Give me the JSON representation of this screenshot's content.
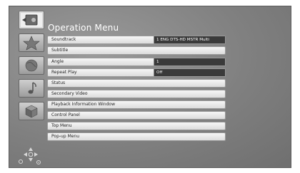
{
  "menu": {
    "title": "Operation Menu",
    "items": [
      {
        "label": "Soundtrack",
        "value": "1 ENG DTS-HD MSTR Multi"
      },
      {
        "label": "Subtitle"
      },
      {
        "label": "Angle",
        "value": "1"
      },
      {
        "label": "Repeat Play",
        "value": "Off"
      },
      {
        "label": "Status"
      },
      {
        "label": "Secondary Video"
      },
      {
        "label": "Playback Information Window"
      },
      {
        "label": "Control Panel"
      },
      {
        "label": "Top Menu"
      },
      {
        "label": "Pop-up Menu"
      }
    ]
  },
  "sidebar": {
    "icons": [
      "disc-icon",
      "star-icon",
      "globe-icon",
      "music-note-icon",
      "cube-icon"
    ],
    "selected": "disc-icon"
  },
  "navigation_hint": {
    "icon": "arrow-keys-icon"
  },
  "colors": {
    "selected_value_bg": "#3a3a3a",
    "screen_bg": "#808080"
  }
}
